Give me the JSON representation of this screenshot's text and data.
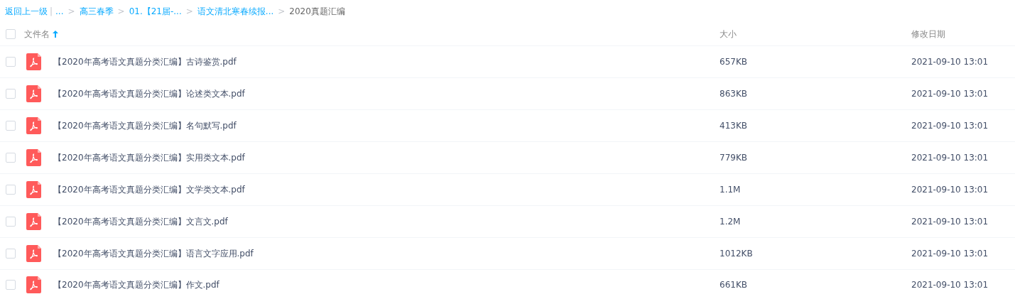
{
  "breadcrumb": [
    {
      "kind": "link",
      "text": "返回上一级"
    },
    {
      "kind": "bar",
      "text": "|"
    },
    {
      "kind": "link",
      "text": "..."
    },
    {
      "kind": "sep",
      "text": ">"
    },
    {
      "kind": "link",
      "text": "高三春季"
    },
    {
      "kind": "sep",
      "text": ">"
    },
    {
      "kind": "link",
      "text": "01.【21届-..."
    },
    {
      "kind": "sep",
      "text": ">"
    },
    {
      "kind": "link",
      "text": "语文清北寒春续报..."
    },
    {
      "kind": "sep",
      "text": ">"
    },
    {
      "kind": "current",
      "text": "2020真题汇编"
    }
  ],
  "table": {
    "select_all": {
      "checked": false
    },
    "columns": [
      {
        "label": "文件名",
        "sort_ascending": true
      },
      {
        "label": "大小"
      },
      {
        "label": "修改日期"
      }
    ],
    "rows": [
      {
        "checked": false,
        "name": "【2020年高考语文真题分类汇编】古诗鉴赏.pdf",
        "size": "657KB",
        "modified": "2021-09-10 13:01"
      },
      {
        "checked": false,
        "name": "【2020年高考语文真题分类汇编】论述类文本.pdf",
        "size": "863KB",
        "modified": "2021-09-10 13:01"
      },
      {
        "checked": false,
        "name": "【2020年高考语文真题分类汇编】名句默写.pdf",
        "size": "413KB",
        "modified": "2021-09-10 13:01"
      },
      {
        "checked": false,
        "name": "【2020年高考语文真题分类汇编】实用类文本.pdf",
        "size": "779KB",
        "modified": "2021-09-10 13:01"
      },
      {
        "checked": false,
        "name": "【2020年高考语文真题分类汇编】文学类文本.pdf",
        "size": "1.1M",
        "modified": "2021-09-10 13:01"
      },
      {
        "checked": false,
        "name": "【2020年高考语文真题分类汇编】文言文.pdf",
        "size": "1.2M",
        "modified": "2021-09-10 13:01"
      },
      {
        "checked": false,
        "name": "【2020年高考语文真题分类汇编】语言文字应用.pdf",
        "size": "1012KB",
        "modified": "2021-09-10 13:01"
      },
      {
        "checked": false,
        "name": "【2020年高考语文真题分类汇编】作文.pdf",
        "size": "661KB",
        "modified": "2021-09-10 13:01"
      }
    ]
  }
}
